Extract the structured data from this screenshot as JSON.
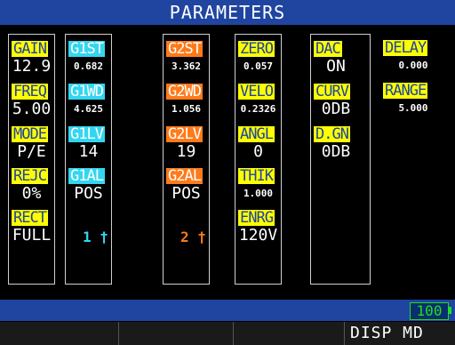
{
  "header": {
    "title": "PARAMETERS"
  },
  "col1": {
    "gain": {
      "label": "GAIN",
      "value": "12.9"
    },
    "freq": {
      "label": "FREQ",
      "value": "5.00"
    },
    "mode": {
      "label": "MODE",
      "value": "P/E"
    },
    "rejc": {
      "label": "REJC",
      "value": "0%"
    },
    "rect": {
      "label": "RECT",
      "value": "FULL"
    }
  },
  "col2": {
    "g1st": {
      "label": "G1ST",
      "value": "0.682"
    },
    "g1wd": {
      "label": "G1WD",
      "value": "4.625"
    },
    "g1lv": {
      "label": "G1LV",
      "value": "14"
    },
    "g1al": {
      "label": "G1AL",
      "value": "POS"
    },
    "probe": "1"
  },
  "col3": {
    "g2st": {
      "label": "G2ST",
      "value": "3.362"
    },
    "g2wd": {
      "label": "G2WD",
      "value": "1.056"
    },
    "g2lv": {
      "label": "G2LV",
      "value": "19"
    },
    "g2al": {
      "label": "G2AL",
      "value": "POS"
    },
    "probe": "2"
  },
  "col4": {
    "zero": {
      "label": "ZERO",
      "value": "0.057"
    },
    "velo": {
      "label": "VELO",
      "value": "0.2326"
    },
    "angl": {
      "label": "ANGL",
      "value": "0"
    },
    "thik": {
      "label": "THIK",
      "value": "1.000"
    },
    "enrg": {
      "label": "ENRG",
      "value": "120V"
    }
  },
  "col5": {
    "dac": {
      "label": "DAC",
      "value": "ON"
    },
    "curv": {
      "label": "CURV",
      "value": "0DB"
    },
    "dgn": {
      "label": "D.GN",
      "value": "0DB"
    }
  },
  "col6": {
    "delay": {
      "label": "DELAY",
      "value": "0.000"
    },
    "range": {
      "label": "RANGE",
      "value": "5.000"
    }
  },
  "status": {
    "battery": "100"
  },
  "softkeys": {
    "k4": "DISP MD"
  },
  "colors": {
    "yellow": "#ffff00",
    "cyan": "#33d6f0",
    "orange": "#ff7a1a",
    "blue": "#1f45a0"
  }
}
